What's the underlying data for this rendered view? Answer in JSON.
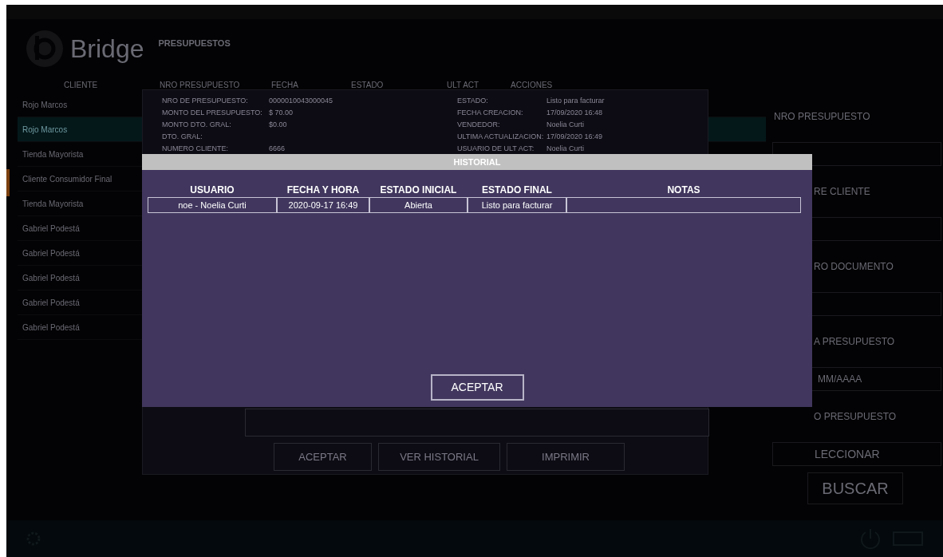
{
  "app": {
    "logo": "Bridge",
    "section_title": "PRESUPUESTOS"
  },
  "list": {
    "columns": [
      "CLIENTE",
      "NRO PRESUPUESTO",
      "FECHA",
      "ESTADO",
      "ULT ACT",
      "ACCIONES"
    ],
    "rows": [
      {
        "client": "Rojo Marcos",
        "selected": false
      },
      {
        "client": "Rojo Marcos",
        "selected": true
      },
      {
        "client": "Tienda Mayorista",
        "selected": false
      },
      {
        "client": "Cliente Consumidor Final",
        "selected": false
      },
      {
        "client": "Tienda Mayorista",
        "selected": false
      },
      {
        "client": "Gabriel Podestá",
        "selected": false
      },
      {
        "client": "Gabriel Podestá",
        "selected": false
      },
      {
        "client": "Gabriel Podestá",
        "selected": false
      },
      {
        "client": "Gabriel Podestá",
        "selected": false
      },
      {
        "client": "Gabriel Podestá",
        "selected": false
      }
    ]
  },
  "detail": {
    "fields_left": [
      {
        "label": "NRO DE PRESUPUESTO:",
        "value": "0000010043000045"
      },
      {
        "label": "MONTO DEL PRESUPUESTO:",
        "value": "$ 70.00"
      },
      {
        "label": "MONTO DTO. GRAL:",
        "value": "$0.00"
      },
      {
        "label": "DTO. GRAL:"
      },
      {
        "label": "NUMERO CLIENTE:",
        "value": "6666"
      }
    ],
    "fields_right": [
      {
        "label": "ESTADO:",
        "value": "Listo para facturar"
      },
      {
        "label": "FECHA CREACION:",
        "value": "17/09/2020 16:48"
      },
      {
        "label": "VENDEDOR:",
        "value": "Noelia Curti"
      },
      {
        "label": "ULTIMA ACTUALIZACION:",
        "value": "17/09/2020 16:49"
      },
      {
        "label": "USUARIO DE ULT ACT:",
        "value": "Noelia Curti"
      }
    ],
    "buttons": [
      "ACEPTAR",
      "VER HISTORIAL",
      "IMPRIMIR"
    ]
  },
  "history": {
    "title": "HISTORIAL",
    "columns": [
      "USUARIO",
      "FECHA Y HORA",
      "ESTADO INICIAL",
      "ESTADO FINAL",
      "NOTAS"
    ],
    "rows": [
      {
        "cells": [
          "noe - Noelia Curti",
          "2020-09-17 16:49",
          "Abierta",
          "Listo para facturar"
        ]
      }
    ],
    "button": "ACEPTAR"
  },
  "search_panel": {
    "items": [
      {
        "kind": "label",
        "text": "NRO PRESUPUESTO"
      },
      {
        "kind": "field"
      },
      {
        "kind": "label",
        "text": "RE CLIENTE"
      },
      {
        "kind": "field"
      },
      {
        "kind": "label",
        "text": "RO DOCUMENTO"
      },
      {
        "kind": "field"
      },
      {
        "kind": "label",
        "text": "A PRESUPUESTO"
      },
      {
        "kind": "date",
        "text": "MM/AAAA"
      },
      {
        "kind": "label",
        "text": "O PRESUPUESTO"
      },
      {
        "kind": "select",
        "text": "LECCIONAR"
      },
      {
        "kind": "button",
        "text": "BUSCAR"
      }
    ]
  }
}
